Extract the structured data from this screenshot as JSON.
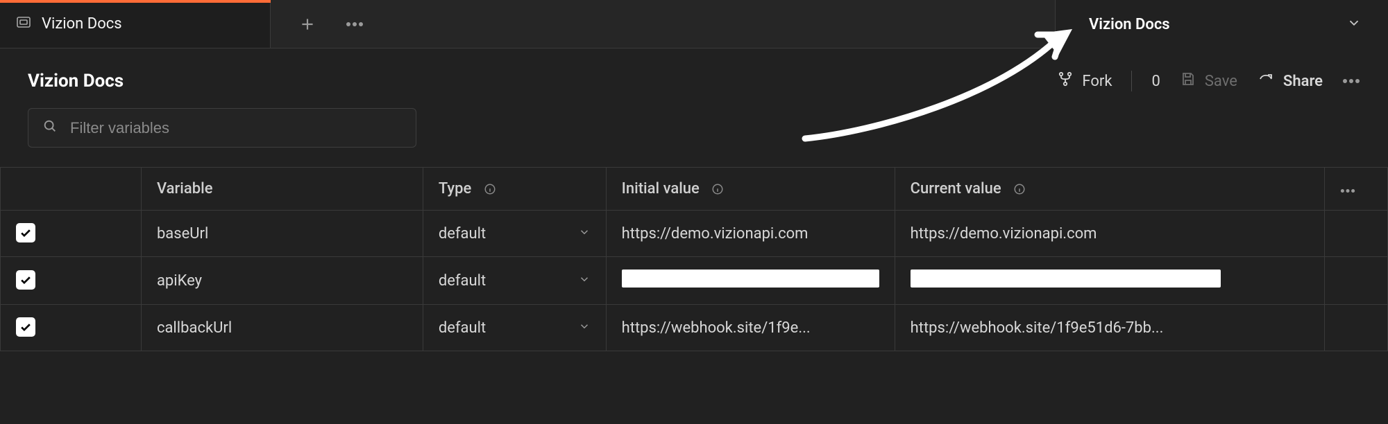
{
  "tab": {
    "label": "Vizion Docs"
  },
  "env_selector": {
    "label": "Vizion Docs"
  },
  "title": "Vizion Docs",
  "toolbar": {
    "fork_label": "Fork",
    "fork_count": "0",
    "save_label": "Save",
    "share_label": "Share"
  },
  "filter": {
    "placeholder": "Filter variables"
  },
  "columns": {
    "variable": "Variable",
    "type": "Type",
    "initial": "Initial value",
    "current": "Current value"
  },
  "rows": [
    {
      "checked": true,
      "variable": "baseUrl",
      "type": "default",
      "initial": "https://demo.vizionapi.com",
      "current": "https://demo.vizionapi.com",
      "redacted": false
    },
    {
      "checked": true,
      "variable": "apiKey",
      "type": "default",
      "initial": "",
      "current": "",
      "redacted": true
    },
    {
      "checked": true,
      "variable": "callbackUrl",
      "type": "default",
      "initial": "https://webhook.site/1f9e...",
      "current": "https://webhook.site/1f9e51d6-7bb...",
      "redacted": false
    }
  ]
}
